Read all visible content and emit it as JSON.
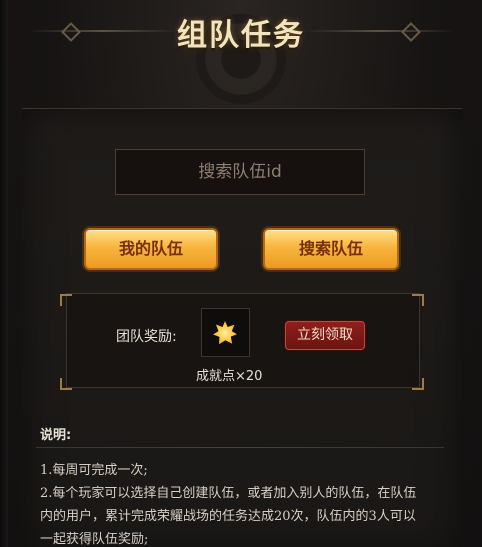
{
  "header": {
    "title": "组队任务"
  },
  "search": {
    "placeholder": "搜索队伍id",
    "value": ""
  },
  "buttons": {
    "my_team": "我的队伍",
    "search_team": "搜索队伍"
  },
  "reward": {
    "label": "团队奖励:",
    "item_icon": "achievement-point-icon",
    "count_text": "成就点×20",
    "claim_label": "立刻领取"
  },
  "description": {
    "title": "说明:",
    "lines": [
      "1.每周可完成一次;",
      "2.每个玩家可以选择自己创建队伍，或者加入别人的队伍，在队伍",
      "内的用户，累计完成荣耀战场的任务达成20次，队伍内的3人可以",
      "一起获得队伍奖励;"
    ]
  },
  "colors": {
    "title": "#f3e4c0",
    "gold_button": "#f8b53d",
    "claim_button": "#8e1f1c",
    "background": "#171413"
  }
}
